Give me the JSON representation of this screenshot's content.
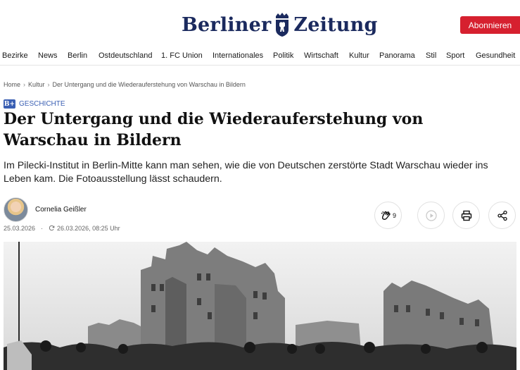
{
  "brand": {
    "logo_left": "Berliner",
    "logo_right": "Zeitung",
    "accent": "#d6202f",
    "logo_color": "#1b2a5e"
  },
  "header": {
    "subscribe_label": "Abonnieren"
  },
  "nav": [
    "Bezirke",
    "News",
    "Berlin",
    "Ostdeutschland",
    "1. FC Union",
    "Internationales",
    "Politik",
    "Wirtschaft",
    "Kultur",
    "Panorama",
    "Stil",
    "Sport",
    "Gesundheit"
  ],
  "breadcrumb": [
    "Home",
    "Kultur",
    "Der Untergang und die Wiederauferstehung von Warschau in Bildern"
  ],
  "article": {
    "badge": "B+",
    "kicker": "GESCHICHTE",
    "headline": "Der Untergang und die Wiederauferstehung von Warschau in Bildern",
    "lead": "Im Pilecki-Institut in Berlin-Mitte kann man sehen, wie die von Deutschen zerstörte Stadt Warschau wieder ins Leben kam. Die Fotoausstellung lässt schaudern.",
    "author": "Cornelia Geißler",
    "published": "25.03.2026",
    "updated": "26.03.2026, 08:25 Uhr"
  },
  "actions": {
    "clap_count": "9",
    "icons": [
      "clap-icon",
      "play-icon",
      "print-icon",
      "share-icon"
    ]
  }
}
